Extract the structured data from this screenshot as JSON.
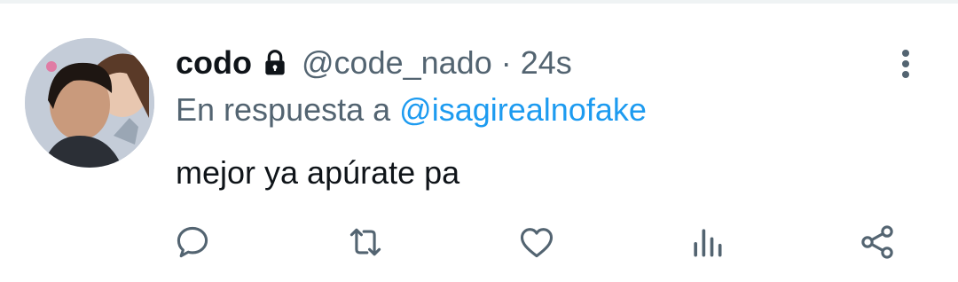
{
  "tweet": {
    "author_name": "codo",
    "author_handle": "@code_nado",
    "separator": "·",
    "timestamp": "24s",
    "reply_prefix": "En respuesta a",
    "reply_to": "@isagirealnofake",
    "text": "mejor ya apúrate pa"
  },
  "icons": {
    "lock": "lock-icon",
    "more": "more-vertical-icon",
    "reply": "reply-icon",
    "retweet": "retweet-icon",
    "like": "heart-icon",
    "views": "analytics-icon",
    "share": "share-icon"
  },
  "colors": {
    "primary_text": "#0f1419",
    "secondary_text": "#536471",
    "mention": "#1d9bf0",
    "icon": "#536471"
  }
}
